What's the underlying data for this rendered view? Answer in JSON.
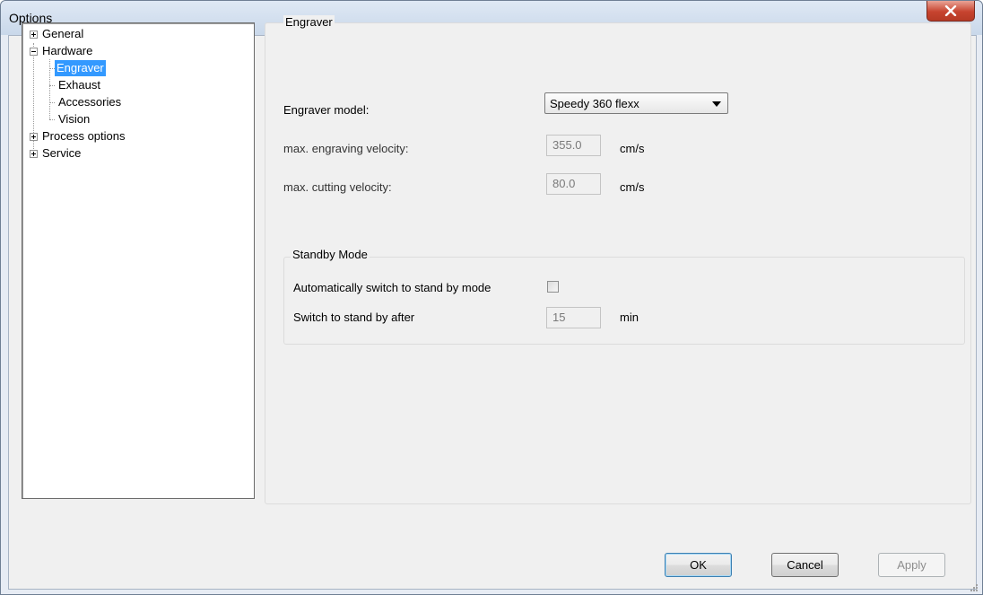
{
  "window": {
    "title": "Options"
  },
  "tree": {
    "items": [
      {
        "label": "General",
        "expander": "plus"
      },
      {
        "label": "Hardware",
        "expander": "minus"
      },
      {
        "label": "Engraver",
        "selected": true
      },
      {
        "label": "Exhaust"
      },
      {
        "label": "Accessories"
      },
      {
        "label": "Vision"
      },
      {
        "label": "Process options",
        "expander": "plus"
      },
      {
        "label": "Service",
        "expander": "plus"
      }
    ]
  },
  "engraver": {
    "group_title": "Engraver",
    "model_label": "Engraver model:",
    "model_value": "Speedy 360 flexx",
    "engraving_velocity_label": "max. engraving velocity:",
    "engraving_velocity_value": "355.0",
    "engraving_velocity_unit": "cm/s",
    "cutting_velocity_label": "max. cutting velocity:",
    "cutting_velocity_value": "80.0",
    "cutting_velocity_unit": "cm/s"
  },
  "standby": {
    "group_title": "Standby Mode",
    "auto_switch_label": "Automatically switch to stand by mode",
    "auto_switch_checked": false,
    "switch_after_label": "Switch to stand by after",
    "switch_after_value": "15",
    "switch_after_unit": "min"
  },
  "buttons": {
    "ok": "OK",
    "cancel": "Cancel",
    "apply": "Apply"
  },
  "icons": {
    "close": "close-icon",
    "resize": "resize-grip-icon"
  }
}
